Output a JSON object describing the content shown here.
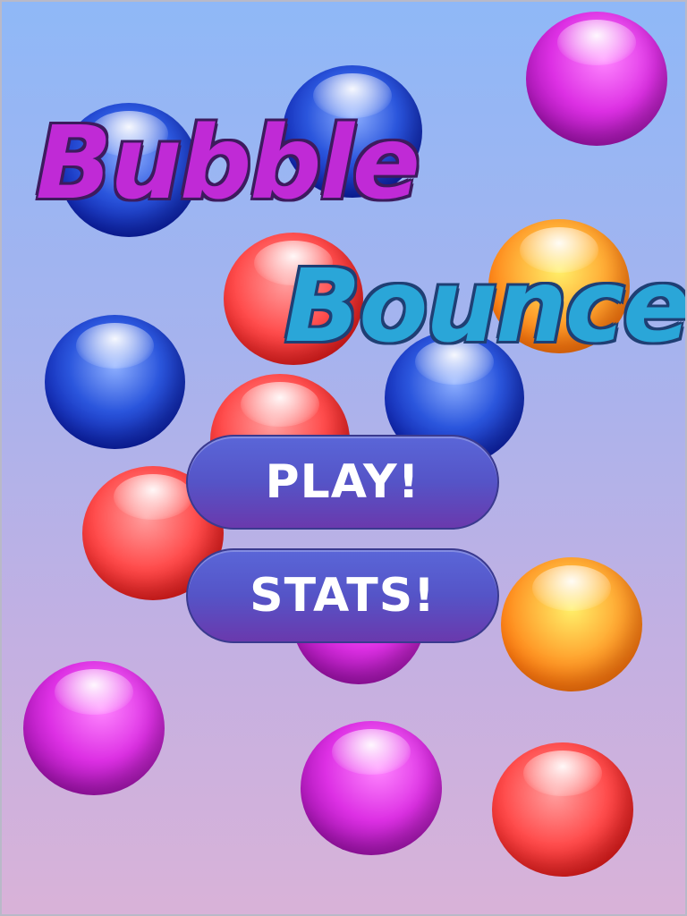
{
  "title": {
    "line1": "Bubble",
    "line2": "Bounce",
    "line1_color": "#c02ad6",
    "line2_color": "#2aa6d8"
  },
  "menu": {
    "play_label": "PLAY!",
    "stats_label": "STATS!",
    "button_color": "#5554c7"
  },
  "background": {
    "top_color": "#8fb8f7",
    "bottom_color": "#d9b2d8"
  },
  "bubble_colors": {
    "blue": "#2b56dd",
    "red": "#ff4d4d",
    "purple": "#dd30e4",
    "orange": "#ff7a10"
  }
}
